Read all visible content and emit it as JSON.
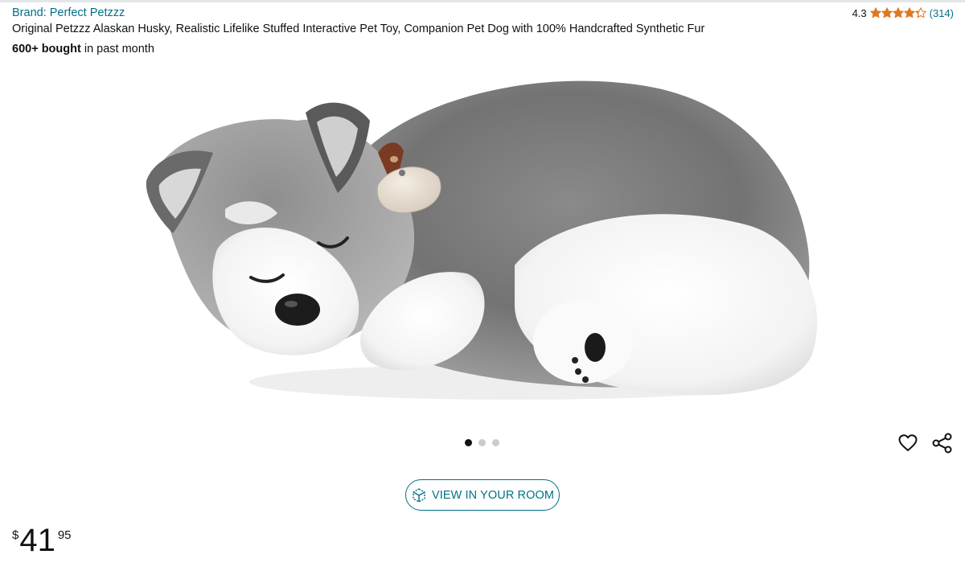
{
  "product": {
    "brand_link": "Brand: Perfect Petzzz",
    "title": "Original Petzzz Alaskan Husky, Realistic Lifelike Stuffed Interactive Pet Toy, Companion Pet Dog with 100% Handcrafted Synthetic Fur",
    "bought_count": "600+ bought",
    "bought_suffix": " in past month"
  },
  "rating": {
    "value": "4.3",
    "count": "(314)",
    "stars": 4.3,
    "star_color": "#de7921"
  },
  "gallery": {
    "image": "sleeping-husky-plush-photo",
    "dot_count": 3,
    "active_dot": 1
  },
  "actions": {
    "wishlist_icon": "heart-icon",
    "share_icon": "share-icon",
    "view_in_room_label": "VIEW IN YOUR ROOM",
    "view_in_room_icon": "cube-3d-icon"
  },
  "price": {
    "symbol": "$",
    "whole": "41",
    "fraction": "95"
  },
  "colors": {
    "link": "#007185",
    "text": "#0f1111",
    "star": "#de7921"
  }
}
